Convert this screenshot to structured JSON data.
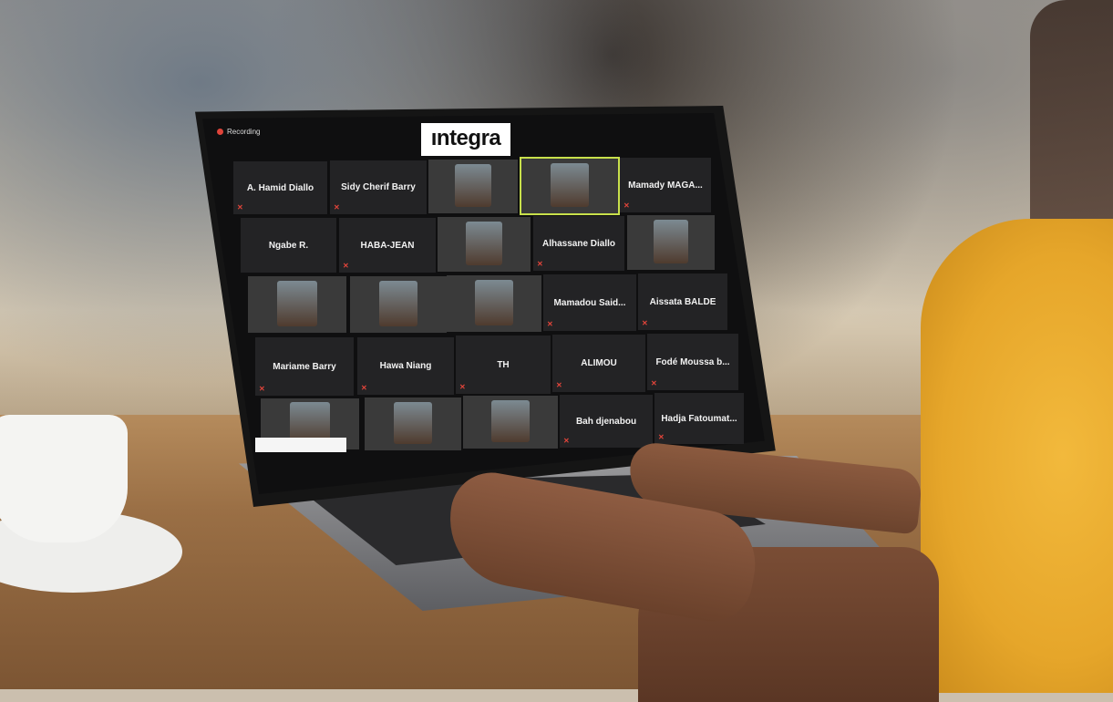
{
  "meeting": {
    "recording_label": "Recording",
    "logo_text": "ıntegra"
  },
  "participants": [
    {
      "name": "A. Hamid Diallo"
    },
    {
      "name": "Sidy Cherif Barry"
    },
    {
      "name": ""
    },
    {
      "name": ""
    },
    {
      "name": "Mamady MAGA..."
    },
    {
      "name": "Ngabe R."
    },
    {
      "name": "HABA-JEAN"
    },
    {
      "name": ""
    },
    {
      "name": "Alhassane Diallo"
    },
    {
      "name": ""
    },
    {
      "name": ""
    },
    {
      "name": ""
    },
    {
      "name": ""
    },
    {
      "name": "Mamadou Said..."
    },
    {
      "name": "Aissata BALDE"
    },
    {
      "name": "Mariame Barry"
    },
    {
      "name": "Hawa Niang"
    },
    {
      "name": "TH"
    },
    {
      "name": "ALIMOU"
    },
    {
      "name": "Fodé Moussa b..."
    },
    {
      "name": ""
    },
    {
      "name": ""
    },
    {
      "name": ""
    },
    {
      "name": "Bah djenabou"
    },
    {
      "name": "Hadja Fatoumat..."
    }
  ]
}
